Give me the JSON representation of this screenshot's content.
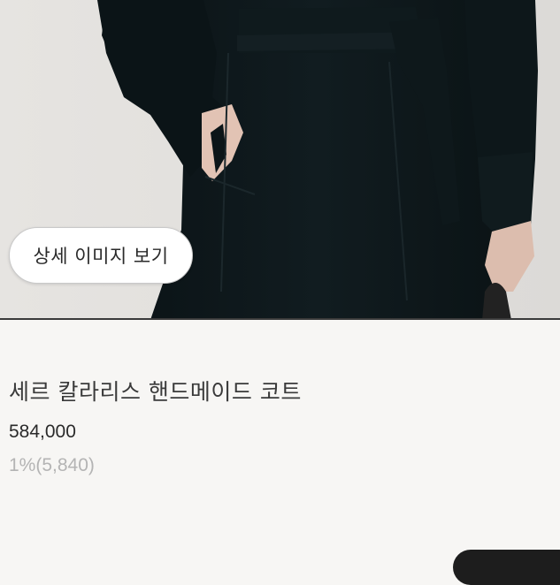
{
  "hero": {
    "image": "black-wrap-coat-model-photo",
    "button_label": "상세 이미지 보기"
  },
  "product": {
    "name": "세르 칼라리스 핸드메이드 코트",
    "price": "584,000",
    "points": "1%(5,840)"
  },
  "colors": {
    "background": "#f7f6f4",
    "coat": "#0c1518",
    "points_text": "#b4b4b4"
  }
}
